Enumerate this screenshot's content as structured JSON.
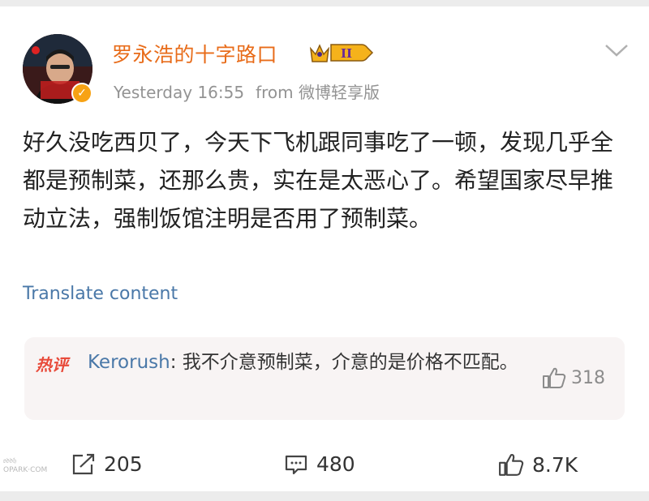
{
  "post": {
    "author": "罗永浩的十字路口",
    "vip_level": "II",
    "avatar_text": "罗永浩的十字路口",
    "timestamp": "Yesterday 16:55",
    "source": "from 微博轻享版",
    "body": "好久没吃西贝了，今天下飞机跟同事吃了一顿，发现几乎全都是预制菜，还那么贵，实在是太恶心了。希望国家尽早推动立法，强制饭馆注明是否用了预制菜。",
    "translate_label": "Translate content"
  },
  "hot_comment": {
    "tag": "热评",
    "user": "Kerorush",
    "text": "我不介意预制菜，介意的是价格不匹配。",
    "likes": "318"
  },
  "actions": {
    "repost_count": "205",
    "comment_count": "480",
    "like_count": "8.7K"
  },
  "watermark": {
    "line1": "𝔬𝔡𝔡𝔥",
    "line2": "OPARK·COM"
  },
  "colors": {
    "author": "#e86c1a",
    "link": "#4a78a8",
    "hot_tag": "#e84a3a",
    "verified": "#f7a214"
  },
  "icons": [
    "chevron-down-icon",
    "verified-icon",
    "vip-crown-icon",
    "thumb-up-icon",
    "repost-icon",
    "comment-icon"
  ]
}
